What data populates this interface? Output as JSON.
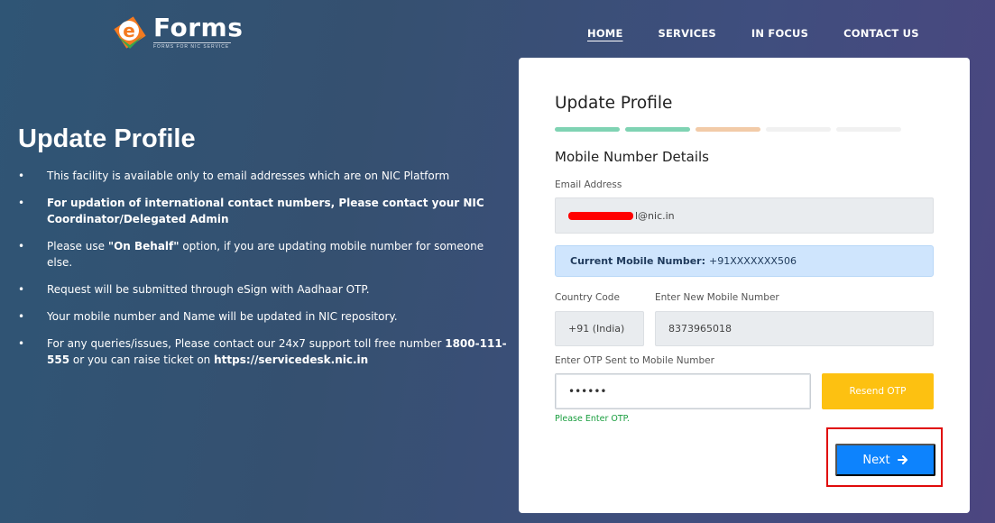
{
  "header": {
    "brand_letter": "e",
    "brand_title": "Forms",
    "brand_subtitle": "FORMS FOR NIC SERVICE",
    "nav": [
      {
        "label": "HOME",
        "active": true
      },
      {
        "label": "SERVICES",
        "active": false
      },
      {
        "label": "IN FOCUS",
        "active": false
      },
      {
        "label": "CONTACT US",
        "active": false
      }
    ]
  },
  "info": {
    "title": "Update Profile",
    "items": [
      {
        "text": "This facility is available only to email addresses which are on NIC Platform"
      },
      {
        "text": "For updation of international contact numbers, Please contact your NIC Coordinator/Delegated Admin"
      },
      {
        "pre": "Please use ",
        "bold": "\"On Behalf\"",
        "post": " option, if you are updating mobile number for someone else."
      },
      {
        "text": "Request will be submitted through eSign with Aadhaar OTP."
      },
      {
        "text": "Your mobile number and Name will be updated in NIC repository."
      },
      {
        "pre": "For any queries/issues, Please contact our 24x7 support toll free number ",
        "bold": "1800-111-555",
        "mid": " or you can raise ticket on ",
        "bold2": "https://servicedesk.nic.in"
      }
    ]
  },
  "card": {
    "title": "Update Profile",
    "progress_colors": [
      "#7fd3b3",
      "#7fd3b3",
      "#f2cba8",
      "#f1f1f1",
      "#f1f1f1"
    ],
    "section_title": "Mobile Number Details",
    "email_label": "Email Address",
    "email_value": "l@nic.in",
    "current_mobile_label": "Current Mobile Number:",
    "current_mobile_value": "+91XXXXXXX506",
    "country_label": "Country Code",
    "country_value": "+91 (India)",
    "new_mobile_label": "Enter New Mobile Number",
    "new_mobile_value": "8373965018",
    "otp_label": "Enter OTP Sent to Mobile Number",
    "otp_value": "••••••",
    "resend_label": "Resend OTP",
    "hint": "Please Enter OTP.",
    "next_label": "Next"
  },
  "colors": {
    "accent": "#0d83fd",
    "resend": "#fdc111",
    "success": "#1a9e3f",
    "highlight": "#e00b0b"
  }
}
